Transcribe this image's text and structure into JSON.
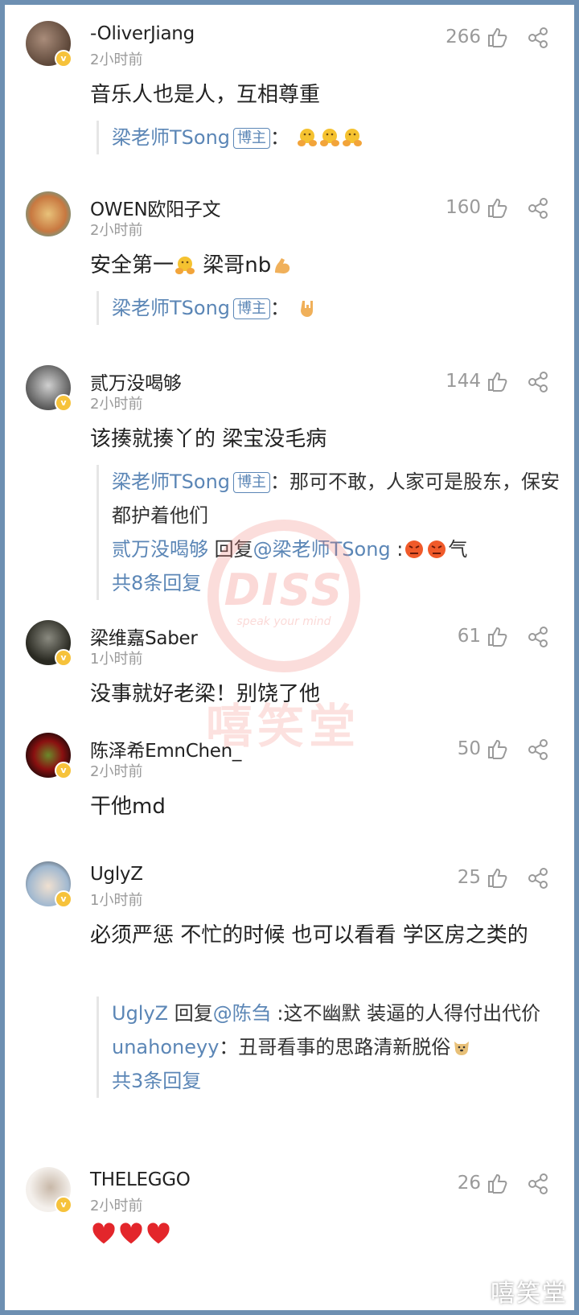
{
  "comments": [
    {
      "username": "-OliverJiang",
      "time": "2小时前",
      "likes": "266",
      "text": "音乐人也是人，互相尊重",
      "replies": [
        {
          "user": "梁老师TSong",
          "tag": "博主",
          "sep": "：",
          "emojis": [
            "hug",
            "hug",
            "hug"
          ]
        }
      ]
    },
    {
      "username": "OWEN欧阳子文",
      "time": "2小时前",
      "likes": "160",
      "text_a": "安全第一",
      "text_b": " 梁哥nb",
      "replies": [
        {
          "user": "梁老师TSong",
          "tag": "博主",
          "sep": "：",
          "emojis": [
            "rock-hand"
          ]
        }
      ]
    },
    {
      "username": "贰万没喝够",
      "time": "2小时前",
      "likes": "144",
      "text": "该揍就揍丫的 梁宝没毛病",
      "replies": [
        {
          "user": "梁老师TSong",
          "tag": "博主",
          "sep": "：",
          "content": "那可不敢，人家可是股东，保安都护着他们"
        },
        {
          "user": "贰万没喝够",
          "reply_word": " 回复",
          "mention": "@梁老师TSong",
          "sep": " :",
          "content_after": "气"
        }
      ],
      "more": "共8条回复"
    },
    {
      "username": "梁维嘉Saber",
      "time": "1小时前",
      "likes": "61",
      "text": "没事就好老梁！别饶了他"
    },
    {
      "username": "陈泽希EmnChen_",
      "time": "2小时前",
      "likes": "50",
      "text": "干他md"
    },
    {
      "username": "UglyZ",
      "time": "1小时前",
      "likes": "25",
      "text": "必须严惩 不忙的时候 也可以看看 学区房之类的",
      "replies": [
        {
          "user": "UglyZ",
          "reply_word": " 回复",
          "mention": "@陈刍",
          "sep": " :",
          "content": "这不幽默 装逼的人得付出代价"
        },
        {
          "user": "unahoneyy",
          "sep": "：",
          "content": "丑哥看事的思路清新脱俗"
        }
      ],
      "more": "共3条回复"
    },
    {
      "username": "THELEGGO",
      "time": "2小时前",
      "likes": "26"
    }
  ],
  "watermark": {
    "main": "DISS",
    "sub": "speak your mind",
    "text": "嘻笑堂"
  },
  "corner_watermark": "嘻笑堂",
  "colors": {
    "link": "#5b86b6",
    "frame": "#6d8fb2",
    "muted": "#9a9a9a"
  }
}
